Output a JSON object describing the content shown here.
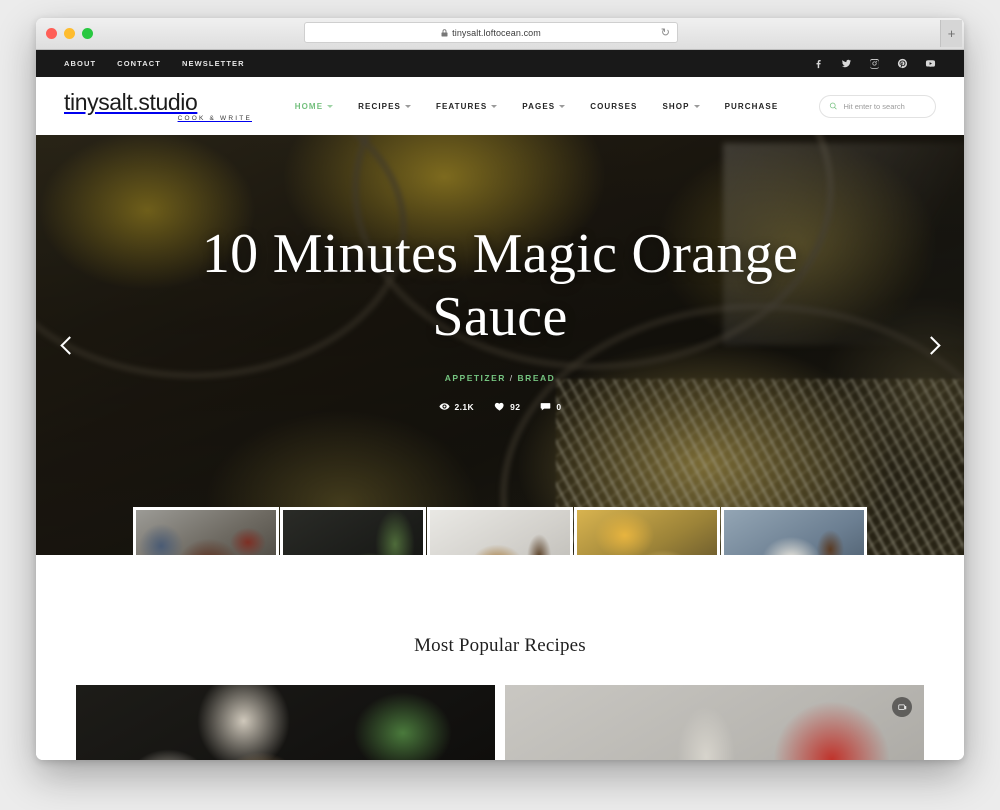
{
  "browser": {
    "url": "tinysalt.loftocean.com",
    "lock_icon": "lock-icon",
    "reload_icon": "reload-icon",
    "new_tab_label": "+"
  },
  "topbar": {
    "links": [
      {
        "label": "ABOUT"
      },
      {
        "label": "CONTACT"
      },
      {
        "label": "NEWSLETTER"
      }
    ],
    "social": [
      {
        "name": "facebook-icon"
      },
      {
        "name": "twitter-icon"
      },
      {
        "name": "instagram-icon"
      },
      {
        "name": "pinterest-icon"
      },
      {
        "name": "youtube-icon"
      }
    ],
    "background_color": "#191919"
  },
  "header": {
    "logo_main": "tinysalt.studio",
    "logo_sub": "COOK & WRITE",
    "nav": [
      {
        "label": "HOME",
        "has_caret": true,
        "active": true
      },
      {
        "label": "RECIPES",
        "has_caret": true,
        "active": false
      },
      {
        "label": "FEATURES",
        "has_caret": true,
        "active": false
      },
      {
        "label": "PAGES",
        "has_caret": true,
        "active": false
      },
      {
        "label": "COURSES",
        "has_caret": false,
        "active": false
      },
      {
        "label": "SHOP",
        "has_caret": true,
        "active": false
      },
      {
        "label": "PURCHASE",
        "has_caret": false,
        "active": false
      }
    ],
    "search": {
      "placeholder": "Hit enter to search",
      "value": "",
      "icon": "search-icon"
    },
    "accent_color": "#74c07e"
  },
  "hero": {
    "title": "10 Minutes Magic Orange Sauce",
    "categories": [
      "APPETIZER",
      "BREAD"
    ],
    "category_separator": "/",
    "meta": {
      "views": "2.1K",
      "likes": "92",
      "comments": "0"
    },
    "prev_arrow": "chevron-left-icon",
    "next_arrow": "chevron-right-icon",
    "thumbnails": [
      {
        "active": false
      },
      {
        "active": false
      },
      {
        "active": false
      },
      {
        "active": true
      },
      {
        "active": false
      }
    ]
  },
  "popular": {
    "title": "Most Popular Recipes",
    "cards": [
      {
        "badge": null
      },
      {
        "badge": "gallery-icon"
      }
    ]
  }
}
